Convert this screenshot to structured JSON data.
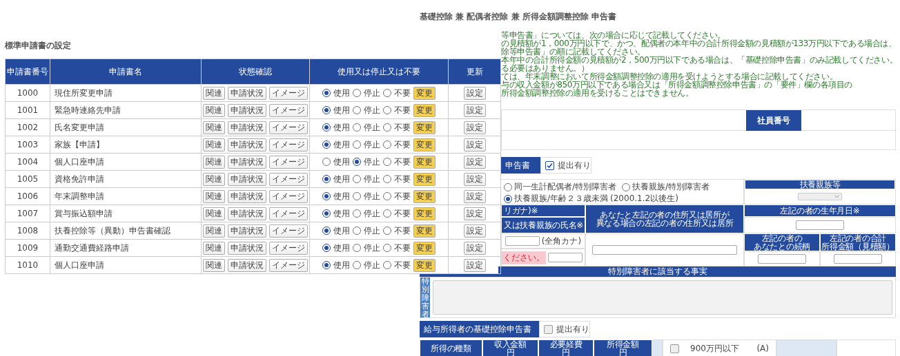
{
  "form_title": "基礎控除 兼 配偶者控除 兼 所得金額調整控除 申告書",
  "settings_panel": {
    "title": "標準申請書の設定",
    "columns": [
      "申請書番号",
      "申請書名",
      "状態確認",
      "使用又は停止又は不要",
      "更新"
    ],
    "rows": [
      {
        "number": "1000",
        "name": "現住所変更申請",
        "buttons": [
          "関連",
          "申請状況",
          "イメージ"
        ],
        "options": [
          {
            "label": "使用",
            "selected": true
          },
          {
            "label": "停止",
            "selected": false
          },
          {
            "label": "不要",
            "selected": false
          }
        ],
        "change_button": "変更",
        "update_button": "設定"
      },
      {
        "number": "1001",
        "name": "緊急時連絡先申請",
        "buttons": [
          "関連",
          "申請状況",
          "イメージ"
        ],
        "options": [
          {
            "label": "使用",
            "selected": true
          },
          {
            "label": "停止",
            "selected": false
          },
          {
            "label": "不要",
            "selected": false
          }
        ],
        "change_button": "変更",
        "update_button": "設定"
      },
      {
        "number": "1002",
        "name": "氏名変更申請",
        "buttons": [
          "関連",
          "申請状況",
          "イメージ"
        ],
        "options": [
          {
            "label": "使用",
            "selected": true
          },
          {
            "label": "停止",
            "selected": false
          },
          {
            "label": "不要",
            "selected": false
          }
        ],
        "change_button": "変更",
        "update_button": "設定"
      },
      {
        "number": "1003",
        "name": "家族【申請】",
        "buttons": [
          "関連",
          "申請状況",
          "イメージ"
        ],
        "options": [
          {
            "label": "使用",
            "selected": true
          },
          {
            "label": "停止",
            "selected": false
          },
          {
            "label": "不要",
            "selected": false
          }
        ],
        "change_button": "変更",
        "update_button": "設定"
      },
      {
        "number": "1004",
        "name": "個人口座申請",
        "buttons": [
          "関連",
          "申請状況",
          "イメージ"
        ],
        "options": [
          {
            "label": "使用",
            "selected": false
          },
          {
            "label": "停止",
            "selected": true
          },
          {
            "label": "不要",
            "selected": false
          }
        ],
        "change_button": "変更",
        "update_button": "設定"
      },
      {
        "number": "1005",
        "name": "資格免許申請",
        "buttons": [
          "関連",
          "申請状況",
          "イメージ"
        ],
        "options": [
          {
            "label": "使用",
            "selected": true
          },
          {
            "label": "停止",
            "selected": false
          },
          {
            "label": "不要",
            "selected": false
          }
        ],
        "change_button": "変更",
        "update_button": "設定"
      },
      {
        "number": "1006",
        "name": "年末調整申請",
        "buttons": [
          "関連",
          "申請状況",
          "イメージ"
        ],
        "options": [
          {
            "label": "使用",
            "selected": true
          },
          {
            "label": "停止",
            "selected": false
          },
          {
            "label": "不要",
            "selected": false
          }
        ],
        "change_button": "変更",
        "update_button": "設定"
      },
      {
        "number": "1007",
        "name": "賞与振込額申請",
        "buttons": [
          "関連",
          "申請状況",
          "イメージ"
        ],
        "options": [
          {
            "label": "使用",
            "selected": true
          },
          {
            "label": "停止",
            "selected": false
          },
          {
            "label": "不要",
            "selected": false
          }
        ],
        "change_button": "変更",
        "update_button": "設定"
      },
      {
        "number": "1008",
        "name": "扶養控除等（異動）申告書確認",
        "buttons": [
          "関連",
          "申請状況",
          "イメージ"
        ],
        "options": [
          {
            "label": "使用",
            "selected": true
          },
          {
            "label": "停止",
            "selected": false
          },
          {
            "label": "不要",
            "selected": false
          }
        ],
        "change_button": "変更",
        "update_button": "設定"
      },
      {
        "number": "1009",
        "name": "通勤交通費経路申請",
        "buttons": [
          "関連",
          "申請状況",
          "イメージ"
        ],
        "options": [
          {
            "label": "使用",
            "selected": true
          },
          {
            "label": "停止",
            "selected": false
          },
          {
            "label": "不要",
            "selected": false
          }
        ],
        "change_button": "変更",
        "update_button": "設定"
      },
      {
        "number": "1010",
        "name": "個人口座申請",
        "buttons": [
          "関連",
          "申請状況",
          "イメージ"
        ],
        "options": [
          {
            "label": "使用",
            "selected": true
          },
          {
            "label": "停止",
            "selected": false
          },
          {
            "label": "不要",
            "selected": false
          }
        ],
        "change_button": "変更",
        "update_button": "設定"
      }
    ]
  },
  "form": {
    "notes": [
      "等申告書」については、次の場合に応じて記載してください。",
      "の見積額が1，000万円以下で、かつ、配偶者の本年中の合計所得金額の見積額が133万円以下である場合は、",
      "除等申告書」の順に記載してください。",
      "本年中の合計所得金額の見積額が2，500万円以下である場合は、「基礎控除申告書」のみ記載してください。",
      "る必要はありません。）",
      "ては、年末調整において所得金額調整控除の適用を受けようとする場合に記載してください。",
      "与の収入金額が850万円以下である場合又は「所得金額調整控除申告書」の「要件」欄の各項目の",
      "所得金額調整控除の適用を受けることはできません。"
    ],
    "employee_label": "社員番号",
    "dependent_section": {
      "title": "申告書",
      "submit": {
        "label": "提出有り",
        "checked": true
      }
    },
    "category_options": [
      {
        "label": "同一生計配偶者/特別障害者",
        "selected": false
      },
      {
        "label": "扶養親族/特別障害者",
        "selected": false
      },
      {
        "label": "扶養親族/年齢２３歳未満",
        "note": "(2000.1.2以後生)",
        "selected": true
      }
    ],
    "dependents_type": {
      "label": "扶養親族等",
      "disabled": true
    },
    "kana_header": "リガナ)※",
    "name_header": "又は扶養親族の氏名※",
    "kana_hint": "(全角カナ)",
    "error": "ください。",
    "address_header": [
      "あなたと左記の者の住所又は居所が",
      "異なる場合の左記の者の住所又は居所"
    ],
    "birth_header": "左記の者の生年月日※",
    "relation_header": [
      "左記の者の",
      "あなたとの続柄"
    ],
    "income_header": [
      "左記の者の合計",
      "所得金額（見積額）"
    ],
    "special": {
      "header": "特別障害者に該当する事実",
      "side_label": "特別障害者"
    },
    "basic_section": {
      "title": "給与所得者の基礎控除申告書",
      "submit": {
        "label": "提出有り",
        "checked": false
      }
    },
    "income_table": {
      "columns": [
        {
          "label": "所得の種類"
        },
        {
          "label": "収入金額",
          "unit": "円"
        },
        {
          "label": "必要経費",
          "unit": "円"
        },
        {
          "label": "所得金額",
          "unit": "円"
        }
      ],
      "option": {
        "label": "900万円以下",
        "mark": "(A)",
        "checked": false
      }
    }
  }
}
